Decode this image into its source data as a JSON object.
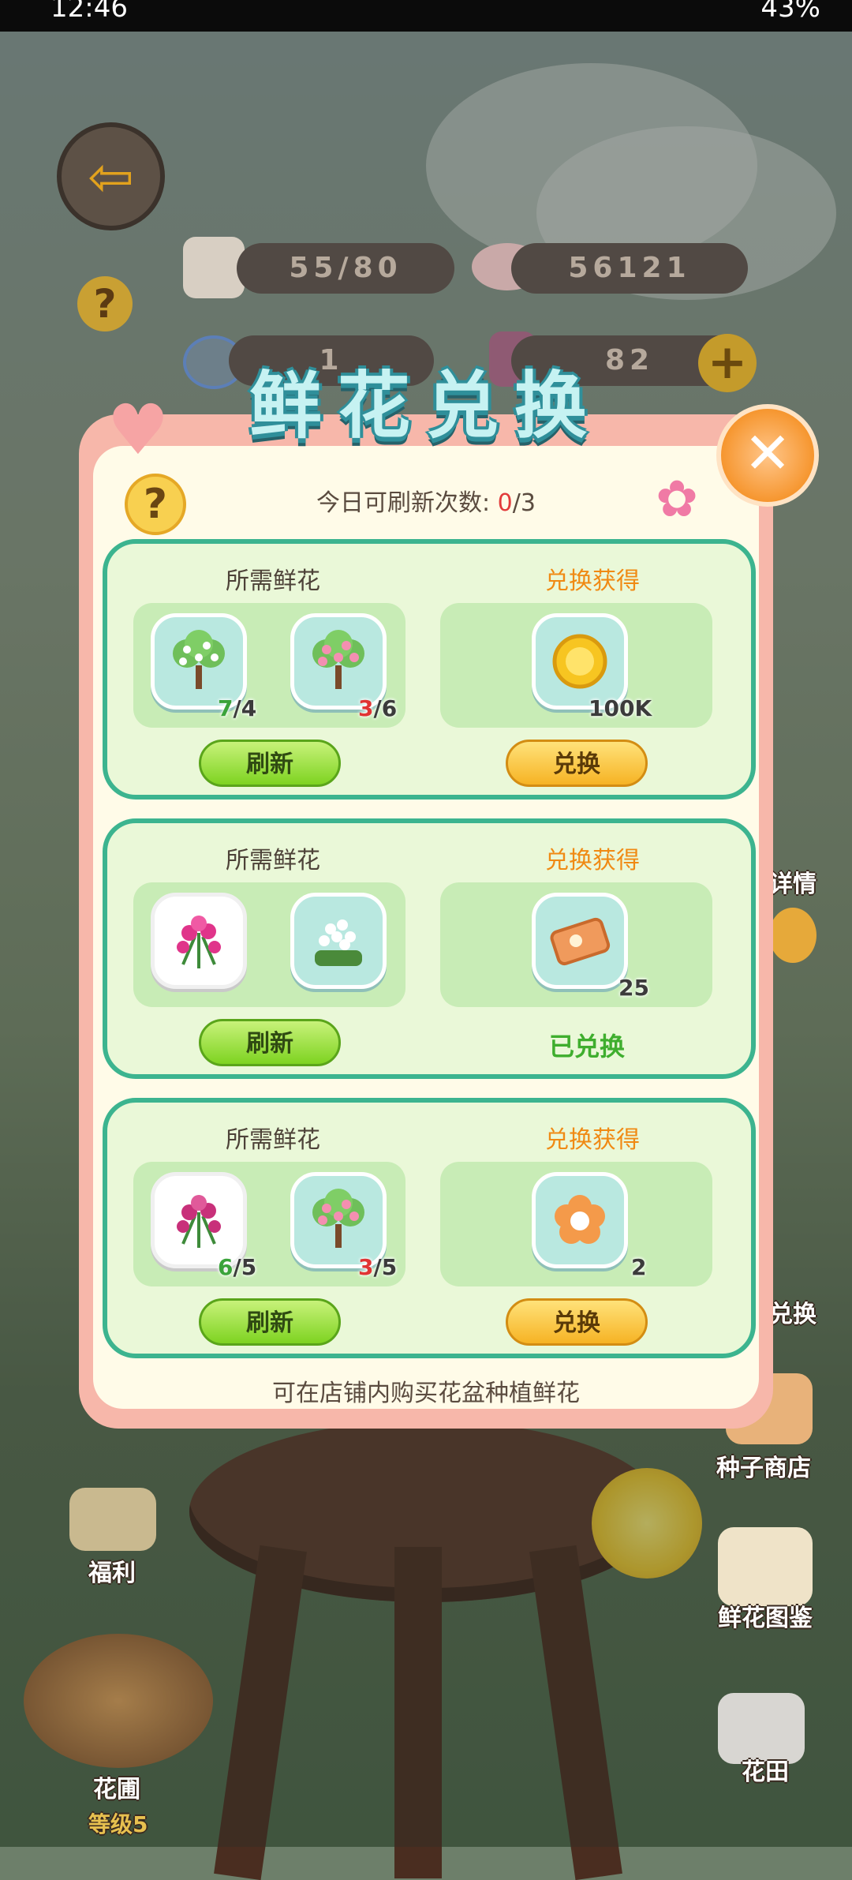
{
  "status_bar": {
    "time": "12:46",
    "battery": "43%"
  },
  "hud": {
    "seed_count": "55/80",
    "petal_count": "56121",
    "row2_left": "1",
    "row2_right": "82"
  },
  "dialog": {
    "title": "鲜花兑换",
    "refresh_label": "今日可刷新次数: ",
    "refresh_used": "0",
    "refresh_total": "/3",
    "footer": "可在店铺内购买花盆种植鲜花"
  },
  "cards": [
    {
      "need_label": "所需鲜花",
      "get_label": "兑换获得",
      "flowers": [
        {
          "name": "white-blossom-tree",
          "have": "7",
          "need": "/4",
          "status": "ok"
        },
        {
          "name": "pink-blossom-tree",
          "have": "3",
          "need": "/6",
          "status": "bad"
        }
      ],
      "reward": {
        "name": "gold-coin",
        "amount": "100K"
      },
      "refresh_btn": "刷新",
      "action_btn": "兑换",
      "state": "available"
    },
    {
      "need_label": "所需鲜花",
      "get_label": "兑换获得",
      "flowers": [
        {
          "name": "pink-lily",
          "have": "",
          "need": "",
          "status": ""
        },
        {
          "name": "white-hyacinth",
          "have": "",
          "need": "",
          "status": ""
        }
      ],
      "reward": {
        "name": "ticket",
        "amount": "25"
      },
      "refresh_btn": "刷新",
      "done_text": "已兑换",
      "state": "redeemed"
    },
    {
      "need_label": "所需鲜花",
      "get_label": "兑换获得",
      "flowers": [
        {
          "name": "pink-lily",
          "have": "6",
          "need": "/5",
          "status": "ok"
        },
        {
          "name": "pink-blossom-tree",
          "have": "3",
          "need": "/5",
          "status": "bad"
        }
      ],
      "reward": {
        "name": "orange-flower-token",
        "amount": "2"
      },
      "refresh_btn": "刷新",
      "action_btn": "兑换",
      "state": "available"
    }
  ],
  "side_buttons": {
    "details": "详情",
    "exchange": "兑换",
    "seed_shop": "种子商店",
    "flower_guide": "鲜花图鉴",
    "flower_field": "花田",
    "welfare": "福利",
    "garden": "花圃",
    "garden_level": "等级5"
  },
  "colors": {
    "card_border": "#3cb48f",
    "card_bg": "#eaf8d8",
    "accent_orange": "#f08a14",
    "ok_green": "#3aa33a",
    "bad_red": "#e03434"
  }
}
